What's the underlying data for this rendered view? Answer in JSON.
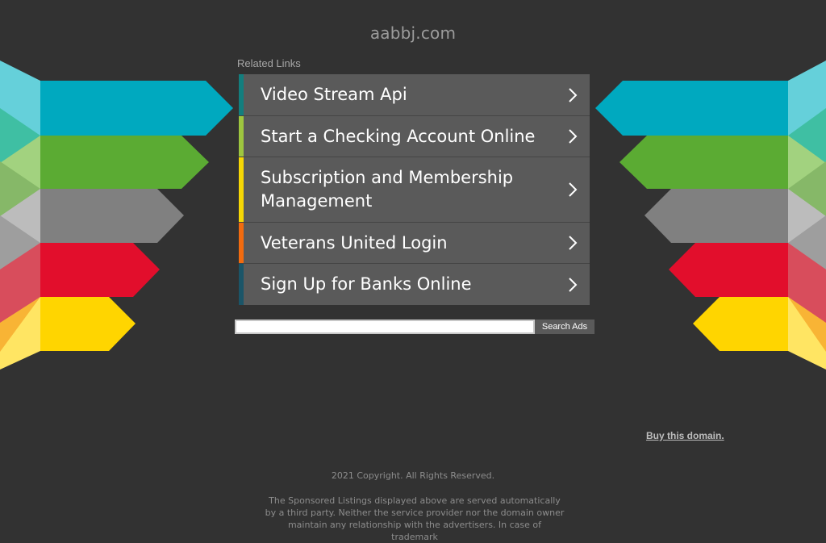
{
  "site": {
    "domain": "aabbj.com"
  },
  "related": {
    "label": "Related Links",
    "links": [
      {
        "label": "Video Stream Api",
        "accent": "#137e7e"
      },
      {
        "label": "Start a Checking Account Online",
        "accent": "#9ec63f"
      },
      {
        "label": "Subscription and Membership Management",
        "accent": "#f6d705"
      },
      {
        "label": "Veterans United Login",
        "accent": "#f26b0f"
      },
      {
        "label": "Sign Up for Banks Online",
        "accent": "#1b5568"
      }
    ]
  },
  "search": {
    "value": "",
    "button_label": "Search Ads"
  },
  "buy": {
    "label": "Buy this domain."
  },
  "footer": {
    "copyright": "2021 Copyright. All Rights Reserved.",
    "disclaimer": "The Sponsored Listings displayed above are served automatically by a third party. Neither the service provider nor the domain owner maintain any relationship with the advertisers. In case of trademark"
  },
  "colors": {
    "background": "#323232",
    "link_row": "#5a5a5a",
    "bands": [
      "#00a9bf",
      "#5bab33",
      "#808080",
      "#e20e2c",
      "#ffd500"
    ]
  }
}
